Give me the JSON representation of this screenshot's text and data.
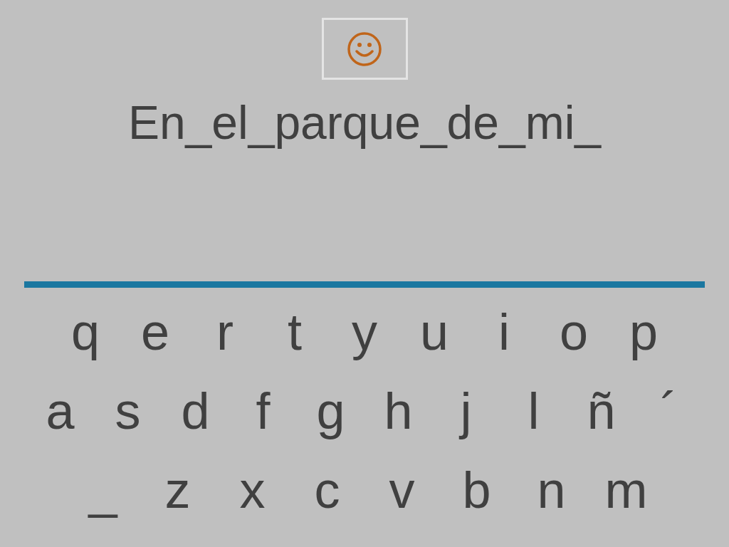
{
  "sentence": "En_el_parque_de_mi_",
  "keyboard": {
    "rows": [
      [
        "q",
        "e",
        "r",
        "t",
        "y",
        "u",
        "i",
        "o",
        "p"
      ],
      [
        "a",
        "s",
        "d",
        "f",
        "g",
        "h",
        "j",
        "l",
        "ñ",
        "´"
      ],
      [
        "_",
        "z",
        "x",
        "c",
        "v",
        "b",
        "n",
        "m"
      ]
    ]
  }
}
